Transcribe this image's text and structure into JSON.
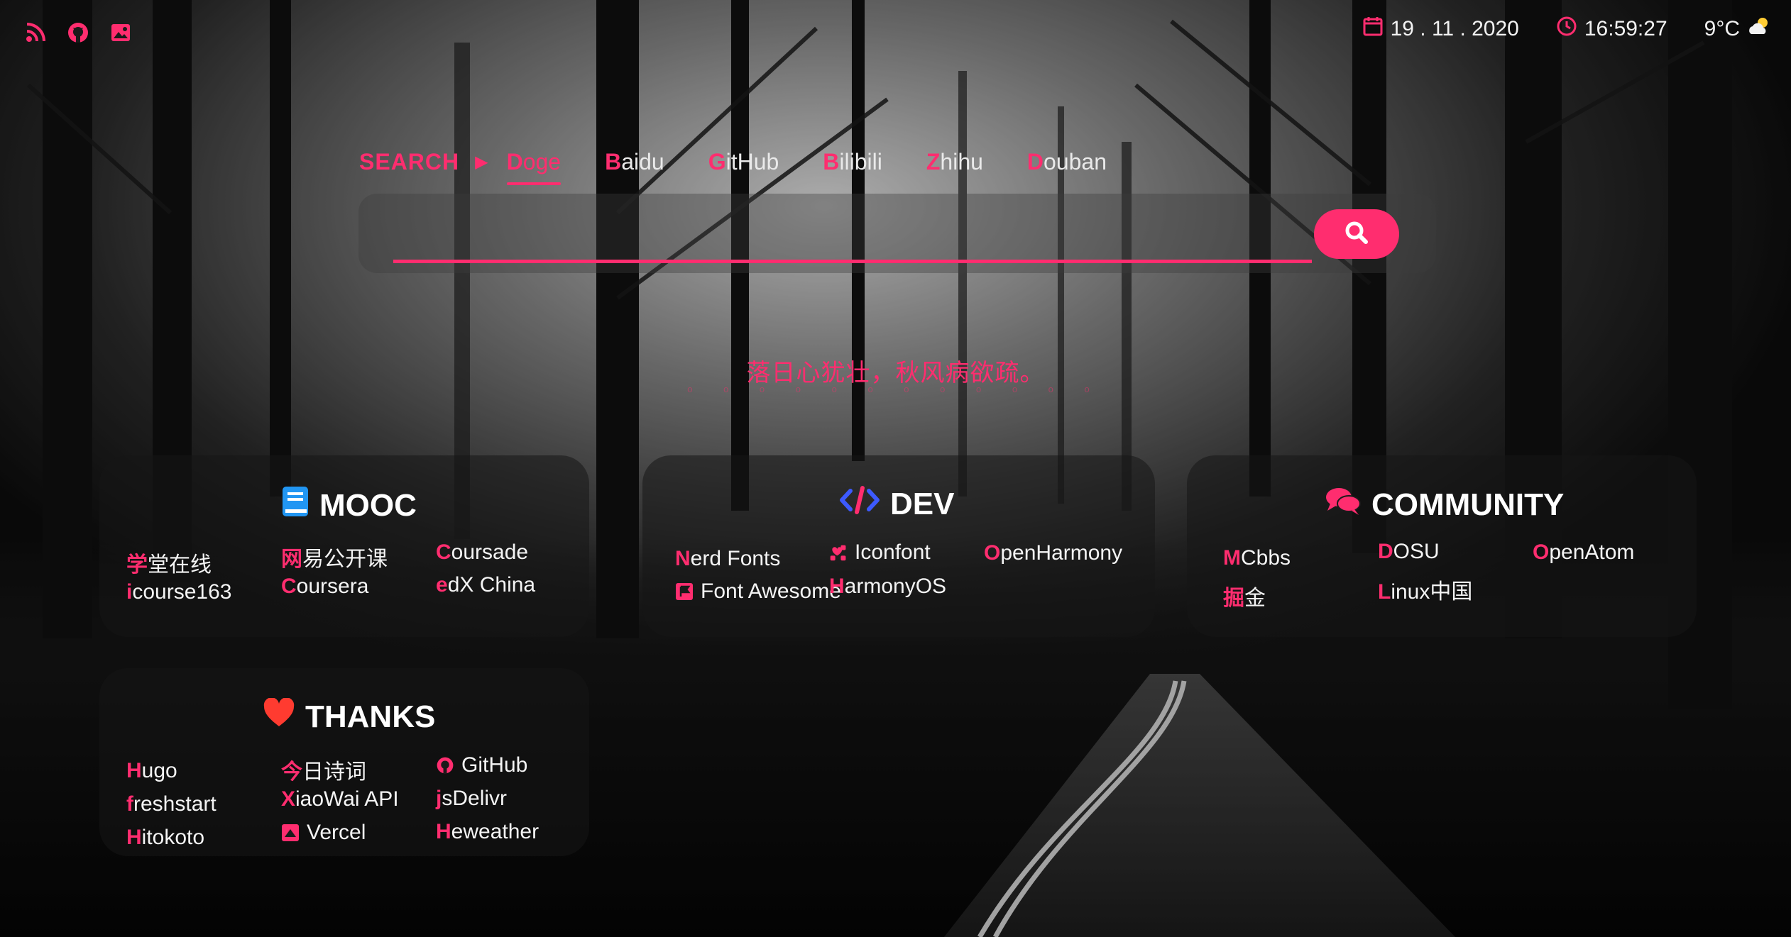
{
  "top_icons": [
    {
      "icon": "rss-icon",
      "color": "#ff2d6f"
    },
    {
      "icon": "github-icon",
      "color": "#ff2d6f"
    },
    {
      "icon": "image-icon",
      "color": "#ff2d6f"
    }
  ],
  "status": {
    "date": "19 . 11 . 2020",
    "time": "16:59:27",
    "weather": "9°C",
    "date_icon": "calendar-icon",
    "time_icon": "clock-icon",
    "weather_icon": "partly-cloudy-icon"
  },
  "search": {
    "lead_label": "SEARCH",
    "engines": [
      {
        "first": "D",
        "rest": "oge"
      },
      {
        "first": "B",
        "rest": "aidu"
      },
      {
        "first": "G",
        "rest": "itHub"
      },
      {
        "first": "B",
        "rest": "ilibili"
      },
      {
        "first": "Z",
        "rest": "hihu"
      },
      {
        "first": "D",
        "rest": "ouban"
      }
    ],
    "active_engine": "Doge",
    "input_value": "",
    "button_icon": "search-icon"
  },
  "poem": {
    "line": "落日心犹壮，秋风病欲疏。",
    "sub": "o o o o o o o o o o o o"
  },
  "cards": {
    "mooc": {
      "title": "MOOC",
      "icon": "book-icon",
      "links": [
        {
          "first": "学",
          "rest": "堂在线"
        },
        {
          "first": "i",
          "rest": "course163"
        },
        {
          "first": "网",
          "rest": "易公开课"
        },
        {
          "first": "C",
          "rest": "oursera"
        },
        {
          "first": "C",
          "rest": "oursade"
        },
        {
          "first": "e",
          "rest": "dX China"
        }
      ]
    },
    "dev": {
      "title": "DEV",
      "icon": "code-icon",
      "links": [
        {
          "first": "N",
          "rest": "erd Fonts"
        },
        {
          "first": "",
          "rest": "Font Awesome",
          "icon": "font-awesome-icon"
        },
        {
          "first": "",
          "rest": "Iconfont",
          "icon": "iconfont-icon"
        },
        {
          "first": "H",
          "rest": "armonyOS"
        },
        {
          "first": "O",
          "rest": "penHarmony"
        }
      ]
    },
    "community": {
      "title": "COMMUNITY",
      "icon": "comments-icon",
      "links": [
        {
          "first": "M",
          "rest": "Cbbs"
        },
        {
          "first": "掘",
          "rest": "金"
        },
        {
          "first": "D",
          "rest": "OSU"
        },
        {
          "first": "L",
          "rest": "inux中国"
        },
        {
          "first": "O",
          "rest": "penAtom"
        }
      ]
    },
    "thanks": {
      "title": "THANKS",
      "icon": "heart-icon",
      "links": [
        {
          "first": "H",
          "rest": "ugo"
        },
        {
          "first": "f",
          "rest": "reshstart"
        },
        {
          "first": "H",
          "rest": "itokoto"
        },
        {
          "first": "今",
          "rest": "日诗词"
        },
        {
          "first": "X",
          "rest": "iaoWai API"
        },
        {
          "first": "",
          "rest": "Vercel",
          "icon": "vercel-icon"
        },
        {
          "first": "",
          "rest": "GitHub",
          "icon": "github-icon"
        },
        {
          "first": "j",
          "rest": "sDelivr"
        },
        {
          "first": "H",
          "rest": "eweather"
        }
      ]
    }
  },
  "colors": {
    "accent": "#ff2d6f",
    "dev_icon": "#3d5afe",
    "mooc_icon": "#2196f3",
    "thanks_icon": "#ff3b30"
  }
}
